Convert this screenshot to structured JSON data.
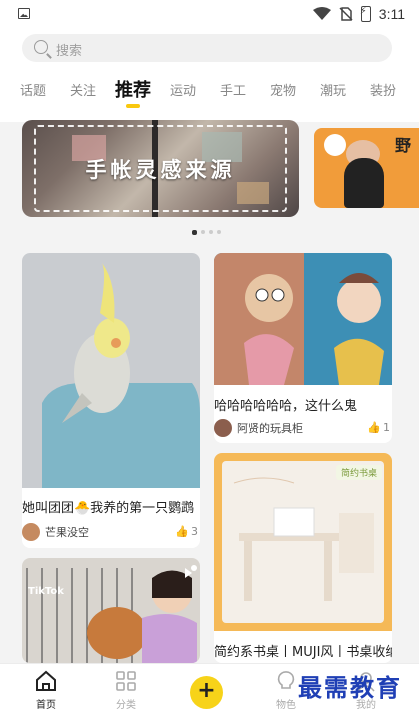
{
  "status_bar": {
    "time": "3:11"
  },
  "search": {
    "placeholder": "搜索"
  },
  "tabs": [
    {
      "label": "话题"
    },
    {
      "label": "关注"
    },
    {
      "label": "推荐"
    },
    {
      "label": "运动"
    },
    {
      "label": "手工"
    },
    {
      "label": "宠物"
    },
    {
      "label": "潮玩"
    },
    {
      "label": "装扮"
    }
  ],
  "active_tab": "推荐",
  "banner": {
    "title": "手帐灵感来源",
    "side_mark": "野",
    "active_index": 0,
    "count": 4
  },
  "feed": [
    {
      "title": "她叫团团🐣我养的第一只鹦鹉",
      "author": "芒果没空",
      "likes": "3"
    },
    {
      "title": "哈哈哈哈哈哈，这什么鬼",
      "author": "阿贤的玩具柜",
      "likes": "1"
    },
    {
      "title": "TikTok",
      "author": "",
      "likes": ""
    },
    {
      "title": "简约系书桌丨MUJI风丨书桌收纳",
      "badge": "简约书桌",
      "author": "",
      "likes": ""
    }
  ],
  "bottom_nav": [
    {
      "label": "首页"
    },
    {
      "label": "分类"
    },
    {
      "label": "+"
    },
    {
      "label": "物色"
    },
    {
      "label": "我的"
    }
  ],
  "watermark": "最需教育",
  "colors": {
    "accent": "#f9c80e",
    "add_button": "#f7d319",
    "watermark": "#1f3fb5"
  }
}
